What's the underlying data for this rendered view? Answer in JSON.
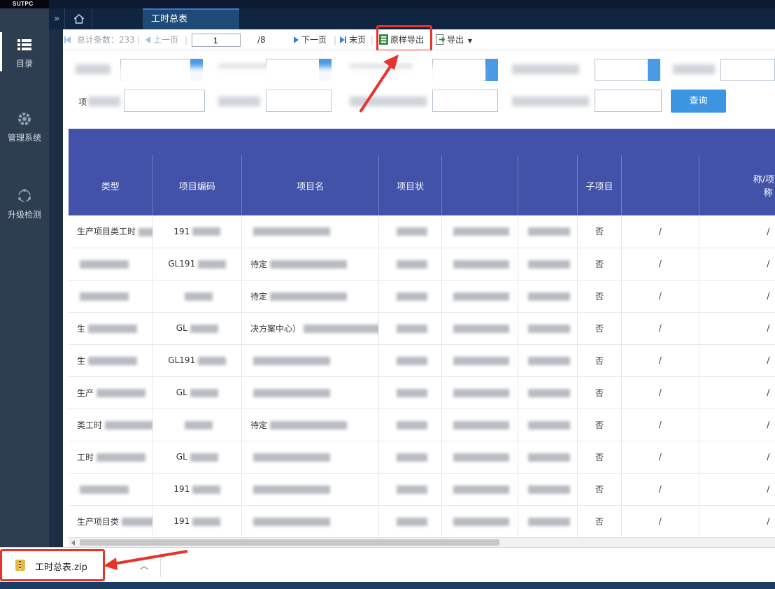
{
  "brand": "SUTPC",
  "sidebar": {
    "items": [
      {
        "label": "目录",
        "icon": "list-icon"
      },
      {
        "label": "管理系统",
        "icon": "gear-icon"
      },
      {
        "label": "升级检测",
        "icon": "sync-icon"
      }
    ]
  },
  "tabbar": {
    "active_tab": "工时总表"
  },
  "toolbar": {
    "total_label": "总计条数：233",
    "prev_label": "上一页",
    "page_value": "1",
    "page_total": "/8",
    "next_label": "下一页",
    "last_label": "末页",
    "raw_export_label": "原样导出",
    "export_label": "导出"
  },
  "filters": {
    "row2_label": "项",
    "query_button": "查询"
  },
  "table": {
    "columns": [
      "类型",
      "项目编码",
      "项目名",
      "项目状",
      "",
      "",
      "子项目",
      "",
      "称/项目\n称"
    ],
    "rows": [
      {
        "type": "生产项目类工时",
        "code": "191",
        "name": "",
        "sub": "否",
        "c8": "/",
        "c9": "/"
      },
      {
        "type": "",
        "code": "GL191",
        "name": "待定",
        "sub": "否",
        "c8": "/",
        "c9": "/"
      },
      {
        "type": "",
        "code": "",
        "name": "待定",
        "sub": "否",
        "c8": "/",
        "c9": "/"
      },
      {
        "type": "生",
        "code": "GL",
        "name": "决方案中心）",
        "sub": "否",
        "c8": "/",
        "c9": "/"
      },
      {
        "type": "生",
        "code": "GL191",
        "name": "",
        "sub": "否",
        "c8": "/",
        "c9": "/"
      },
      {
        "type": "生产",
        "code": "GL",
        "name": "",
        "sub": "否",
        "c8": "/",
        "c9": "/"
      },
      {
        "type": "类工时",
        "code": "",
        "name": "待定",
        "sub": "否",
        "c8": "/",
        "c9": "/"
      },
      {
        "type": "工时",
        "code": "GL",
        "name": "",
        "sub": "否",
        "c8": "/",
        "c9": "/"
      },
      {
        "type": "",
        "code": "191",
        "name": "",
        "sub": "否",
        "c8": "/",
        "c9": "/"
      },
      {
        "type": "生产项目类",
        "code": "191",
        "name": "",
        "sub": "否",
        "c8": "/",
        "c9": "/"
      }
    ],
    "status_samples": [
      "进行中",
      "进行中"
    ]
  },
  "download": {
    "file_name": "工时总表.zip"
  },
  "colors": {
    "sidebar_bg": "#2d3e50",
    "header_bg": "#4252a8",
    "accent": "#3b95e0",
    "highlight": "#e8332a"
  }
}
